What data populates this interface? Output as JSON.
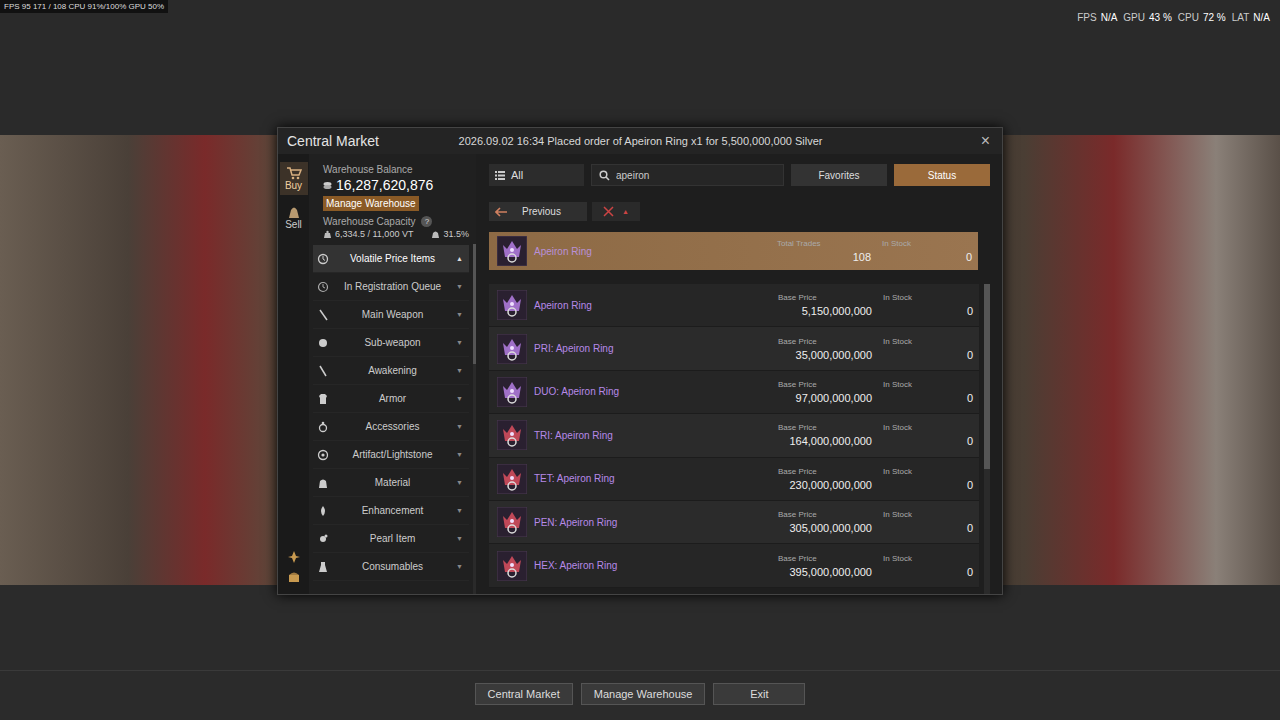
{
  "overlay": {
    "left": "FPS 95  171 / 108  CPU 91%/100%  GPU 50%",
    "right": [
      {
        "label": "FPS",
        "value": "N/A"
      },
      {
        "label": "GPU",
        "value": "43 %"
      },
      {
        "label": "CPU",
        "value": "72 %"
      },
      {
        "label": "LAT",
        "value": "N/A"
      }
    ]
  },
  "window": {
    "title": "Central Market",
    "notice": "2026.09.02 16:34 Placed order of Apeiron Ring x1 for 5,500,000,000 Silver",
    "close": "×"
  },
  "side_tabs": [
    {
      "label": "Buy",
      "selected": true
    },
    {
      "label": "Sell",
      "selected": false
    }
  ],
  "warehouse": {
    "balance_label": "Warehouse Balance",
    "balance": "16,287,620,876",
    "manage": "Manage Warehouse",
    "capacity_label": "Warehouse Capacity",
    "help": "?",
    "capacity": "6,334.5 / 11,000 VT",
    "percent": "31.5%"
  },
  "categories": [
    {
      "label": "Volatile Price Items",
      "selected": true,
      "expanded": true,
      "arrow": "▲"
    },
    {
      "label": "In Registration Queue",
      "selected": false,
      "expanded": false,
      "arrow": "▼"
    },
    {
      "label": "Main Weapon",
      "selected": false,
      "expanded": false,
      "arrow": "▼"
    },
    {
      "label": "Sub-weapon",
      "selected": false,
      "expanded": false,
      "arrow": "▼"
    },
    {
      "label": "Awakening",
      "selected": false,
      "expanded": false,
      "arrow": "▼"
    },
    {
      "label": "Armor",
      "selected": false,
      "expanded": false,
      "arrow": "▼"
    },
    {
      "label": "Accessories",
      "selected": false,
      "expanded": false,
      "arrow": "▼"
    },
    {
      "label": "Artifact/Lightstone",
      "selected": false,
      "expanded": false,
      "arrow": "▼"
    },
    {
      "label": "Material",
      "selected": false,
      "expanded": false,
      "arrow": "▼"
    },
    {
      "label": "Enhancement",
      "selected": false,
      "expanded": false,
      "arrow": "▼"
    },
    {
      "label": "Pearl Item",
      "selected": false,
      "expanded": false,
      "arrow": "▼"
    },
    {
      "label": "Consumables",
      "selected": false,
      "expanded": false,
      "arrow": "▼"
    }
  ],
  "filter": {
    "category": "All",
    "search": "apeiron",
    "buttons": [
      {
        "label": "Favorites",
        "selected": false
      },
      {
        "label": "Status",
        "selected": true
      }
    ]
  },
  "nav": {
    "previous": "Previous",
    "sort_arrow": "▲"
  },
  "header_row": {
    "name": "Apeiron Ring",
    "trades_label": "Total Trades",
    "trades": "108",
    "stock_label": "In Stock",
    "stock": "0",
    "color": "#a070c8"
  },
  "items": [
    {
      "name": "Apeiron Ring",
      "price_label": "Base Price",
      "price": "5,150,000,000",
      "stock_label": "In Stock",
      "stock": "0",
      "color": "#a070c8"
    },
    {
      "name": "PRI: Apeiron Ring",
      "price_label": "Base Price",
      "price": "35,000,000,000",
      "stock_label": "In Stock",
      "stock": "0",
      "color": "#a070c8"
    },
    {
      "name": "DUO: Apeiron Ring",
      "price_label": "Base Price",
      "price": "97,000,000,000",
      "stock_label": "In Stock",
      "stock": "0",
      "color": "#a070c8"
    },
    {
      "name": "TRI: Apeiron Ring",
      "price_label": "Base Price",
      "price": "164,000,000,000",
      "stock_label": "In Stock",
      "stock": "0",
      "color": "#c04858"
    },
    {
      "name": "TET: Apeiron Ring",
      "price_label": "Base Price",
      "price": "230,000,000,000",
      "stock_label": "In Stock",
      "stock": "0",
      "color": "#c04858"
    },
    {
      "name": "PEN: Apeiron Ring",
      "price_label": "Base Price",
      "price": "305,000,000,000",
      "stock_label": "In Stock",
      "stock": "0",
      "color": "#c04858"
    },
    {
      "name": "HEX: Apeiron Ring",
      "price_label": "Base Price",
      "price": "395,000,000,000",
      "stock_label": "In Stock",
      "stock": "0",
      "color": "#c04858"
    }
  ],
  "bottom_buttons": [
    "Central Market",
    "Manage Warehouse",
    "Exit"
  ]
}
